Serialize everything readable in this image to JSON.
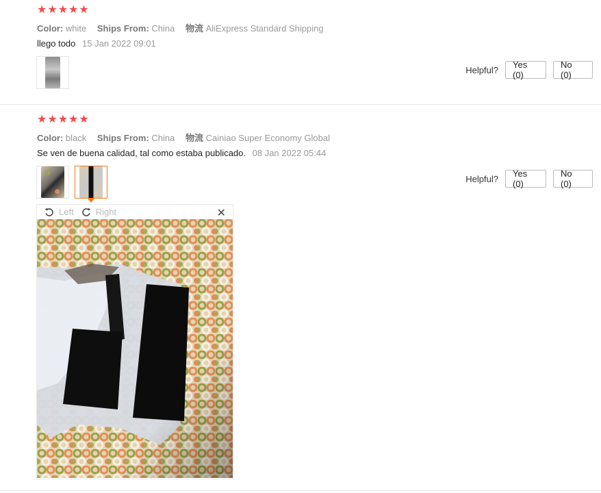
{
  "reviews": [
    {
      "stars": 5,
      "color_key": "Color:",
      "color_val": "white",
      "ships_key": "Ships From:",
      "ships_val": "China",
      "logistics_key": "物流",
      "logistics_val": "AliExpress Standard Shipping",
      "text": "llego todo",
      "date": "15 Jan 2022 09:01",
      "helpful_label": "Helpful?",
      "yes_label": "Yes (0)",
      "no_label": "No (0)"
    },
    {
      "stars": 5,
      "color_key": "Color:",
      "color_val": "black",
      "ships_key": "Ships From:",
      "ships_val": "China",
      "logistics_key": "物流",
      "logistics_val": "Cainiao Super Economy Global",
      "text": "Se ven de buena calidad, tal como estaba publicado.",
      "date": "08 Jan 2022 05:44",
      "helpful_label": "Helpful?",
      "yes_label": "Yes (0)",
      "no_label": "No (0)",
      "viewer": {
        "rotate_left_label": "Left",
        "rotate_right_label": "Right",
        "close_glyph": "✕"
      }
    }
  ],
  "colors": {
    "star": "#f5484c",
    "active_thumb": "#f07c1a"
  },
  "icons": {
    "star": "★",
    "rotate_left": "rotate-left-icon",
    "rotate_right": "rotate-right-icon"
  }
}
